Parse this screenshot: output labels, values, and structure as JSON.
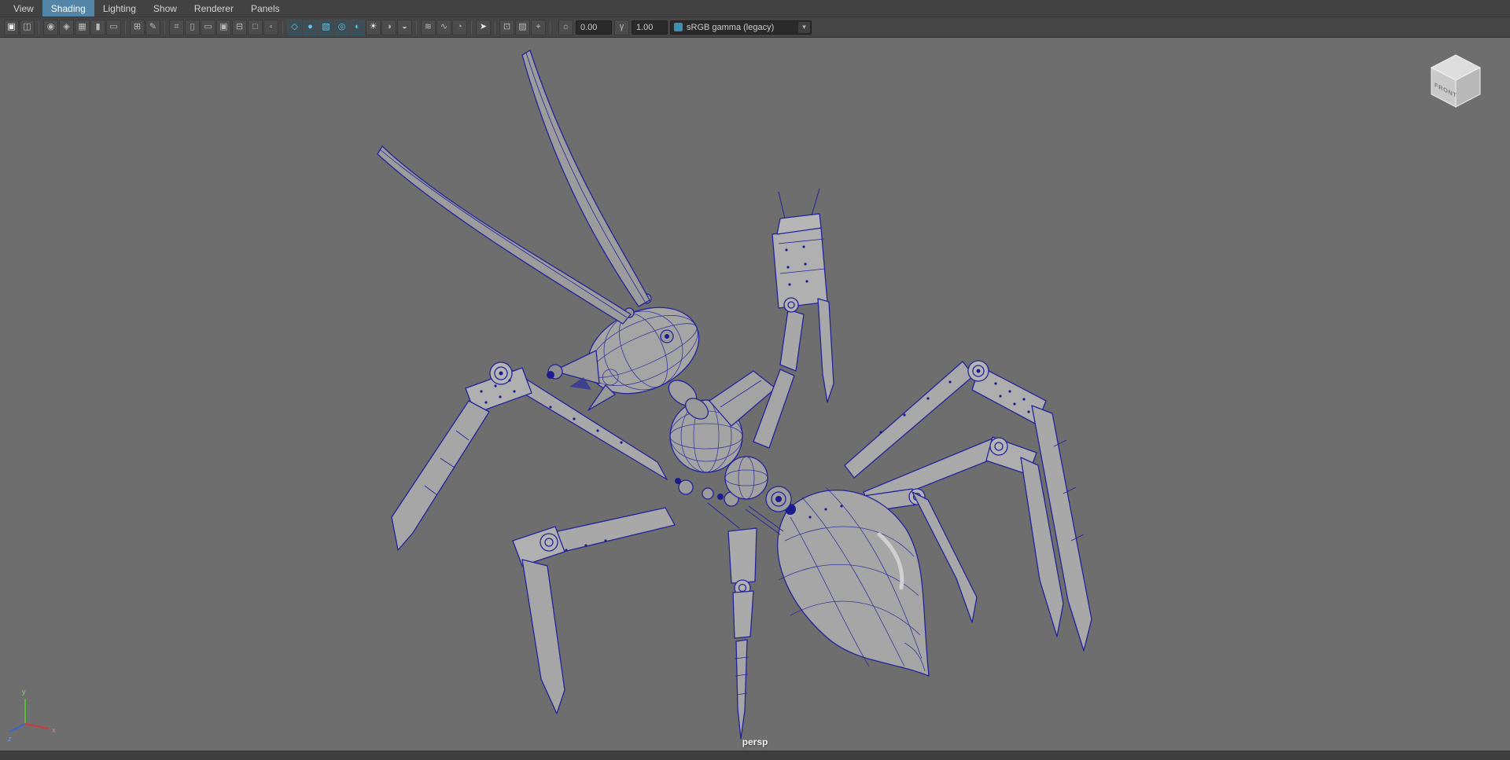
{
  "menubar": {
    "items": [
      {
        "name": "menu-item-view",
        "label": "View"
      },
      {
        "name": "menu-item-shading",
        "label": "Shading",
        "selected": true
      },
      {
        "name": "menu-item-lighting",
        "label": "Lighting"
      },
      {
        "name": "menu-item-show",
        "label": "Show"
      },
      {
        "name": "menu-item-renderer",
        "label": "Renderer"
      },
      {
        "name": "menu-item-panels",
        "label": "Panels"
      }
    ]
  },
  "toolbar": {
    "items": [
      {
        "name": "single-pane-layout-icon",
        "glyph": "▣",
        "tone": "bright"
      },
      {
        "name": "saved-layouts-icon",
        "glyph": "◫"
      },
      {
        "sep": true
      },
      {
        "name": "select-camera-icon",
        "glyph": "◉"
      },
      {
        "name": "lock-camera-icon",
        "glyph": "◈"
      },
      {
        "name": "camera-attributes-icon",
        "glyph": "▦"
      },
      {
        "name": "bookmarks-icon",
        "glyph": "▮"
      },
      {
        "name": "image-plane-icon",
        "glyph": "▭"
      },
      {
        "sep": true
      },
      {
        "name": "two-d-pan-zoom-icon",
        "glyph": "⊞"
      },
      {
        "name": "grease-pencil-icon",
        "glyph": "✎"
      },
      {
        "sep": true
      },
      {
        "name": "grid-icon",
        "glyph": "⌗"
      },
      {
        "name": "film-gate-icon",
        "glyph": "▯"
      },
      {
        "name": "resolution-gate-icon",
        "glyph": "▭"
      },
      {
        "name": "gate-mask-icon",
        "glyph": "▣"
      },
      {
        "name": "field-chart-icon",
        "glyph": "⊟"
      },
      {
        "name": "safe-action-icon",
        "glyph": "□"
      },
      {
        "name": "safe-title-icon",
        "glyph": "▫"
      },
      {
        "sep": true
      },
      {
        "name": "wireframe-icon",
        "glyph": "◇",
        "active": true
      },
      {
        "name": "smooth-shade-all-icon",
        "glyph": "●",
        "active": true
      },
      {
        "name": "textured-icon",
        "glyph": "▧",
        "active": true
      },
      {
        "name": "wireframe-on-shaded-icon",
        "glyph": "◎",
        "active": true
      },
      {
        "name": "use-default-material-icon",
        "glyph": "◐",
        "active": true
      },
      {
        "name": "use-all-lights-icon",
        "glyph": "☀",
        "tone": "bright"
      },
      {
        "name": "shadows-icon",
        "glyph": "◑"
      },
      {
        "name": "screen-space-ambient-occlusion-icon",
        "glyph": "◒"
      },
      {
        "sep": true
      },
      {
        "name": "motion-blur-icon",
        "glyph": "≋"
      },
      {
        "name": "multisample-anti-aliasing-icon",
        "glyph": "∿"
      },
      {
        "name": "depth-of-field-icon",
        "glyph": "◔"
      },
      {
        "sep": true
      },
      {
        "name": "selection-arrow-icon",
        "glyph": "➤",
        "tone": "bright"
      },
      {
        "sep": true
      },
      {
        "name": "isolate-select-icon",
        "glyph": "⊡"
      },
      {
        "name": "x-ray-icon",
        "glyph": "▨"
      },
      {
        "name": "x-ray-joints-icon",
        "glyph": "⌖"
      },
      {
        "sep": true
      }
    ],
    "exposure_icon": "☼",
    "exposure_label": "0.00",
    "gamma_icon": "γ",
    "gamma_label": "1.00",
    "view_transform": "sRGB gamma (legacy)",
    "dropdown_arrow": "▾"
  },
  "viewport": {
    "camera_label": "persp",
    "viewcube_label": "FRONT",
    "axis": {
      "x": "x",
      "y": "y",
      "z": "z"
    },
    "colors": {
      "background": "#6e6e6e",
      "wireframe": "#23239b",
      "model_fill": "#a5a5a5",
      "selection": "#5285a6",
      "active_icon": "#66c6e3"
    }
  }
}
